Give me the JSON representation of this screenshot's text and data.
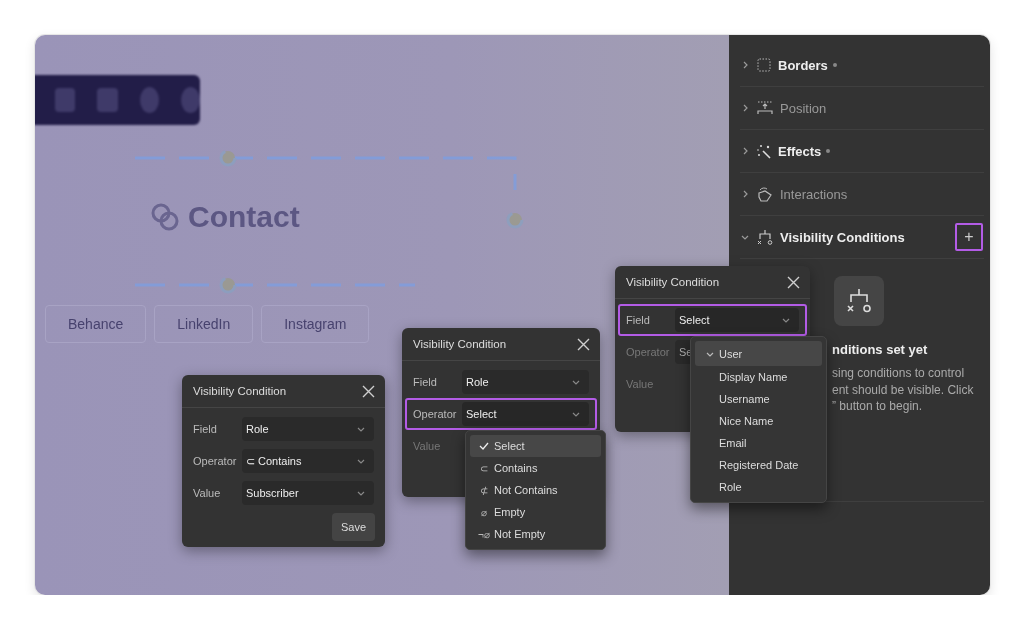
{
  "canvas": {
    "heading": "Contact",
    "links": [
      "Behance",
      "LinkedIn",
      "Instagram"
    ]
  },
  "panel": {
    "sections": [
      {
        "label": "Borders",
        "modified": true,
        "expanded": false
      },
      {
        "label": "Position",
        "modified": false,
        "expanded": false
      },
      {
        "label": "Effects",
        "modified": true,
        "expanded": false
      },
      {
        "label": "Interactions",
        "modified": false,
        "expanded": false
      },
      {
        "label": "Visibility Conditions",
        "modified": false,
        "expanded": true,
        "add_button": "+"
      }
    ],
    "empty_state": {
      "title": "nditions set yet",
      "lines": [
        "sing conditions to control",
        "ent should be visible. Click",
        "” button to begin."
      ]
    }
  },
  "dialogs": [
    {
      "title": "Visibility Condition",
      "rows": [
        {
          "label": "Field",
          "value": "Role",
          "highlighted": false,
          "disabled": false
        },
        {
          "label": "Operator",
          "value": "⊂ Contains",
          "highlighted": false,
          "disabled": false
        },
        {
          "label": "Value",
          "value": "Subscriber",
          "highlighted": false,
          "disabled": false
        }
      ],
      "button": "Save"
    },
    {
      "title": "Visibility Condition",
      "rows": [
        {
          "label": "Field",
          "value": "Role",
          "highlighted": false,
          "disabled": false
        },
        {
          "label": "Operator",
          "value": "Select",
          "highlighted": true,
          "disabled": false
        },
        {
          "label": "Value",
          "highlighted": false,
          "disabled": true
        }
      ],
      "menu": [
        {
          "kind": "option",
          "label": "Select",
          "selected": true
        },
        {
          "kind": "option",
          "symbol": "⊂",
          "label": "Contains",
          "selected": false
        },
        {
          "kind": "option",
          "symbol": "⊄",
          "label": "Not Contains",
          "selected": false
        },
        {
          "kind": "option",
          "symbol": "⌀",
          "label": "Empty",
          "selected": false
        },
        {
          "kind": "option",
          "symbol": "¬⌀",
          "label": "Not Empty",
          "selected": false
        }
      ]
    },
    {
      "title": "Visibility Condition",
      "rows": [
        {
          "label": "Field",
          "value": "Select",
          "highlighted": true,
          "disabled": false
        },
        {
          "label": "Operator",
          "value": "Se",
          "highlighted": false,
          "disabled": true
        },
        {
          "label": "Value",
          "highlighted": false,
          "disabled": true
        }
      ],
      "menu": [
        {
          "kind": "group",
          "label": "User",
          "expanded": true,
          "selected": true
        },
        {
          "kind": "option",
          "label": "Display Name",
          "selected": false
        },
        {
          "kind": "option",
          "label": "Username",
          "selected": false
        },
        {
          "kind": "option",
          "label": "Nice Name",
          "selected": false
        },
        {
          "kind": "option",
          "label": "Email",
          "selected": false
        },
        {
          "kind": "option",
          "label": "Registered Date",
          "selected": false
        },
        {
          "kind": "option",
          "label": "Role",
          "selected": false
        }
      ]
    }
  ]
}
